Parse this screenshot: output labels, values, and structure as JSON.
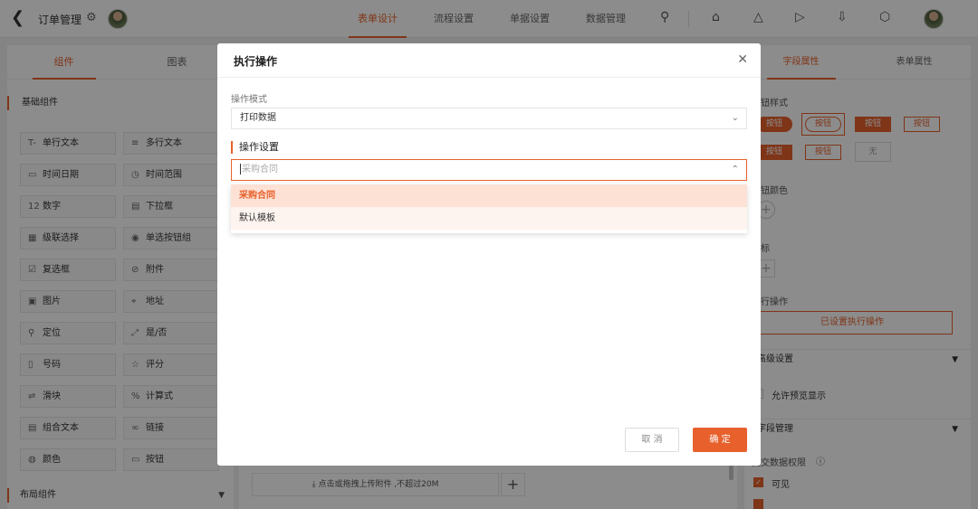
{
  "header": {
    "title": "订单管理",
    "tabs": [
      {
        "label": "表单设计",
        "active": true
      },
      {
        "label": "流程设置",
        "active": false
      },
      {
        "label": "单据设置",
        "active": false
      },
      {
        "label": "数据管理",
        "active": false
      }
    ]
  },
  "left_panel": {
    "tabs": [
      "组件",
      "图表"
    ],
    "section_basic": "基础组件",
    "components": [
      {
        "icon": "T-",
        "label": "单行文本"
      },
      {
        "icon": "≡",
        "label": "多行文本"
      },
      {
        "icon": "▭",
        "label": "时间日期"
      },
      {
        "icon": "◷",
        "label": "时间范围"
      },
      {
        "icon": "12",
        "label": "数字"
      },
      {
        "icon": "▤",
        "label": "下拉框"
      },
      {
        "icon": "▦",
        "label": "级联选择"
      },
      {
        "icon": "◉",
        "label": "单选按钮组"
      },
      {
        "icon": "☑",
        "label": "复选框"
      },
      {
        "icon": "⊘",
        "label": "附件"
      },
      {
        "icon": "▣",
        "label": "图片"
      },
      {
        "icon": "⌖",
        "label": "地址"
      },
      {
        "icon": "⚲",
        "label": "定位"
      },
      {
        "icon": "⤢",
        "label": "是/否"
      },
      {
        "icon": "▯",
        "label": "号码"
      },
      {
        "icon": "☆",
        "label": "评分"
      },
      {
        "icon": "⇌",
        "label": "滑块"
      },
      {
        "icon": "%",
        "label": "计算式"
      },
      {
        "icon": "▤",
        "label": "组合文本"
      },
      {
        "icon": "∞",
        "label": "链接"
      },
      {
        "icon": "◍",
        "label": "颜色"
      },
      {
        "icon": "▭",
        "label": "按钮"
      }
    ],
    "section_layout": "布局组件"
  },
  "center": {
    "upload_text": "点击或拖拽上传附件 ,不超过20M",
    "plus": "+"
  },
  "right_panel": {
    "tabs": [
      "字段属性",
      "表单属性"
    ],
    "button_style_label": "按钮样式",
    "sample_label": "按钮",
    "none_label": "无",
    "button_color_label": "按钮颜色",
    "icon_label": "图标",
    "exec_label": "执行操作",
    "exec_button": "已设置执行操作",
    "advanced_label": "高级设置",
    "allow_preview": "允许预览显示",
    "field_mgmt_label": "字段管理",
    "submit_perm_label": "提交数据权限",
    "visible_label": "可见"
  },
  "modal": {
    "title": "执行操作",
    "mode_label": "操作模式",
    "mode_value": "打印数据",
    "settings_label": "操作设置",
    "input_placeholder": "采购合同",
    "options": [
      "采购合同",
      "默认模板"
    ],
    "cancel": "取 消",
    "ok": "确 定"
  },
  "colors": {
    "accent": "#e8612c"
  }
}
